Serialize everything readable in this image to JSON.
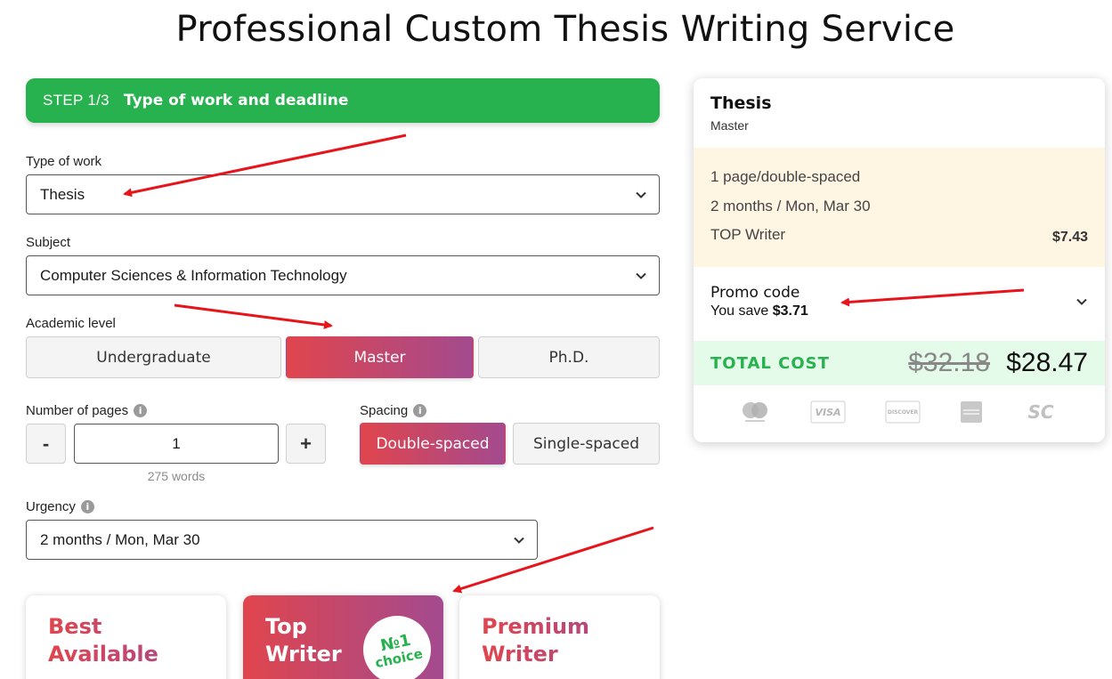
{
  "page": {
    "title": "Professional Custom Thesis Writing Service"
  },
  "step": {
    "number": "STEP 1/3",
    "label": "Type of work and deadline"
  },
  "type_of_work": {
    "label": "Type of work",
    "value": "Thesis"
  },
  "subject": {
    "label": "Subject",
    "value": "Computer Sciences & Information Technology"
  },
  "academic_level": {
    "label": "Academic level",
    "options": [
      "Undergraduate",
      "Master",
      "Ph.D."
    ],
    "selected": "Master"
  },
  "pages": {
    "label": "Number of pages",
    "value": "1",
    "words": "275 words",
    "minus": "-",
    "plus": "+"
  },
  "spacing": {
    "label": "Spacing",
    "options": [
      "Double-spaced",
      "Single-spaced"
    ],
    "selected": "Double-spaced"
  },
  "urgency": {
    "label": "Urgency",
    "value": "2 months / Mon, Mar 30"
  },
  "writers": {
    "options": [
      "Best\nAvailable",
      "Top\nWriter",
      "Premium\nWriter"
    ],
    "selected": "Top Writer",
    "badge_line1": "№1",
    "badge_line2": "choice"
  },
  "summary": {
    "title": "Thesis",
    "level": "Master",
    "pages_line": "1 page/double-spaced",
    "deadline_line": "2 months / Mon, Mar 30",
    "writer_line": "TOP Writer",
    "writer_price": "$7.43",
    "promo_label": "Promo code",
    "promo_save_text": "You save",
    "promo_save_amount": "$3.71",
    "total_label": "TOTAL COST",
    "old_price": "$32.18",
    "new_price": "$28.47"
  },
  "payment_icons": [
    "mastercard-icon",
    "visa-icon",
    "discover-icon",
    "amex-icon",
    "sc-icon"
  ],
  "payment_text": {
    "visa": "VISA",
    "discover": "DISCOVER",
    "sc": "SC"
  },
  "colors": {
    "green": "#27b24f",
    "gradient_start": "#e0454d",
    "gradient_end": "#a34a8f",
    "annotation_arrow": "#e8141c"
  }
}
